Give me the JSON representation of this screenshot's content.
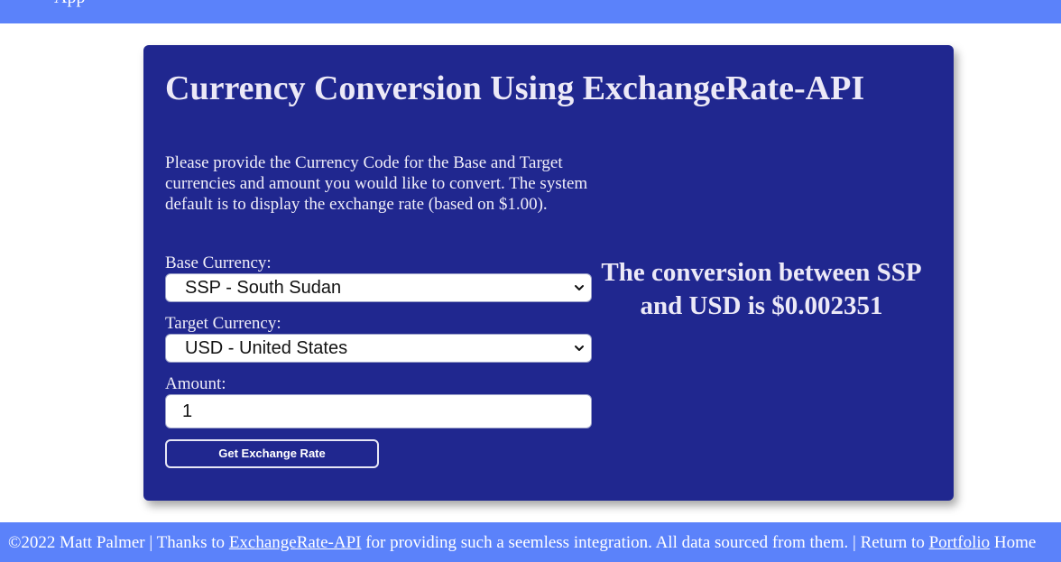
{
  "header": {
    "partial_text": "App"
  },
  "card": {
    "title": "Currency Conversion Using ExchangeRate-API",
    "instructions": "Please provide the Currency Code for the Base and Target currencies and amount you would like to convert. The system default is to display the exchange rate (based on $1.00).",
    "base": {
      "label": "Base Currency:",
      "value": "SSP - South Sudan"
    },
    "target": {
      "label": "Target Currency:",
      "value": "USD - United States"
    },
    "amount": {
      "label": "Amount:",
      "value": "1"
    },
    "button_label": "Get Exchange Rate",
    "result": "The conversion between SSP and USD is $0.002351"
  },
  "footer": {
    "copyright": "©2022 Matt Palmer | Thanks to ",
    "api_link": "ExchangeRate-API",
    "middle": " for providing such a seemless integration. All data sourced from them. | Return to ",
    "portfolio_link": "Portfolio",
    "trailing": " Home"
  },
  "colors": {
    "nav_bar": "#5b82fa",
    "card_background": "#20278f",
    "text_light": "#ece9f7"
  },
  "icons": {
    "dropdown": "chevron-down-icon"
  }
}
